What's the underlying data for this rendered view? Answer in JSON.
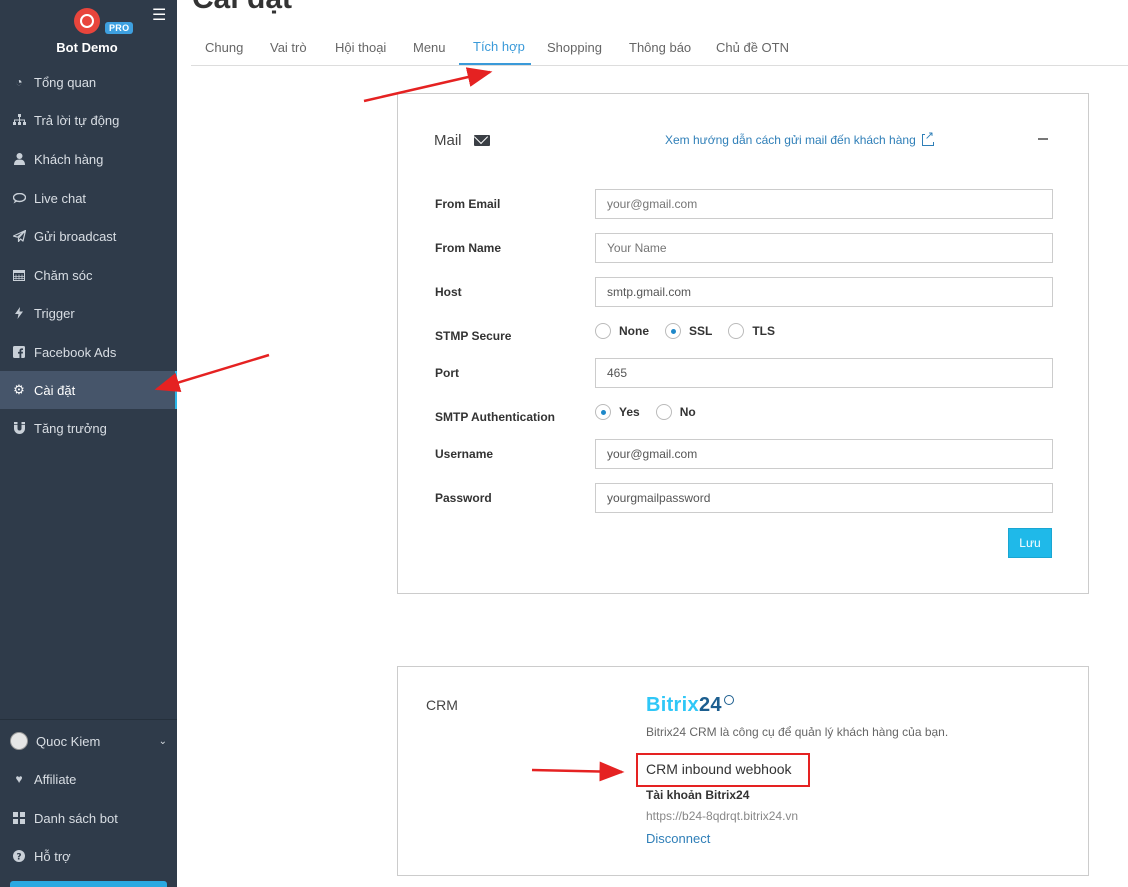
{
  "brand": {
    "name": "Bot Demo",
    "badge": "PRO"
  },
  "sidebar": {
    "items": [
      {
        "label": "Tổng quan",
        "icon": "dashboard-icon"
      },
      {
        "label": "Trả lời tự động",
        "icon": "sitemap-icon"
      },
      {
        "label": "Khách hàng",
        "icon": "user-icon"
      },
      {
        "label": "Live chat",
        "icon": "chat-icon"
      },
      {
        "label": "Gửi broadcast",
        "icon": "paper-plane-icon"
      },
      {
        "label": "Chăm sóc",
        "icon": "calendar-icon"
      },
      {
        "label": "Trigger",
        "icon": "bolt-icon"
      },
      {
        "label": "Facebook Ads",
        "icon": "facebook-icon"
      },
      {
        "label": "Cài đặt",
        "icon": "gear-icon",
        "active": true
      },
      {
        "label": "Tăng trưởng",
        "icon": "magnet-icon"
      }
    ],
    "footer": [
      {
        "label": "Quoc Kiem",
        "icon": "avatar"
      },
      {
        "label": "Affiliate",
        "icon": "heart-icon"
      },
      {
        "label": "Danh sách bot",
        "icon": "grid-icon"
      },
      {
        "label": "Hỗ trợ",
        "icon": "question-icon"
      }
    ]
  },
  "page": {
    "title": "Cài đặt"
  },
  "tabs": [
    {
      "label": "Chung"
    },
    {
      "label": "Vai trò"
    },
    {
      "label": "Hội thoại"
    },
    {
      "label": "Menu"
    },
    {
      "label": "Tích hợp",
      "active": true
    },
    {
      "label": "Shopping"
    },
    {
      "label": "Thông báo"
    },
    {
      "label": "Chủ đề OTN"
    }
  ],
  "mail": {
    "title": "Mail",
    "guide_link": "Xem hướng dẫn cách gửi mail đến khách hàng",
    "fields": {
      "from_email": {
        "label": "From Email",
        "placeholder": "your@gmail.com"
      },
      "from_name": {
        "label": "From Name",
        "placeholder": "Your Name"
      },
      "host": {
        "label": "Host",
        "value": "smtp.gmail.com"
      },
      "secure": {
        "label": "STMP Secure",
        "options": [
          "None",
          "SSL",
          "TLS"
        ],
        "selected": "SSL"
      },
      "port": {
        "label": "Port",
        "value": "465"
      },
      "auth": {
        "label": "SMTP Authentication",
        "options": [
          "Yes",
          "No"
        ],
        "selected": "Yes"
      },
      "username": {
        "label": "Username",
        "value": "your@gmail.com"
      },
      "password": {
        "label": "Password",
        "value": "yourgmailpassword"
      }
    },
    "save_label": "Lưu"
  },
  "crm": {
    "title": "CRM",
    "logo_text_a": "Bitrix",
    "logo_text_b": "24",
    "description": "Bitrix24 CRM là công cụ để quản lý khách hàng của bạn.",
    "webhook_title": "CRM inbound webhook",
    "account_label": "Tài khoản Bitrix24",
    "account_url": "https://b24-8qdrqt.bitrix24.vn",
    "disconnect_label": "Disconnect"
  },
  "colors": {
    "sidebar_bg": "#2f3b4a",
    "accent": "#3a9ad9",
    "save_button": "#1fb9e9",
    "annotation": "#e52222"
  }
}
